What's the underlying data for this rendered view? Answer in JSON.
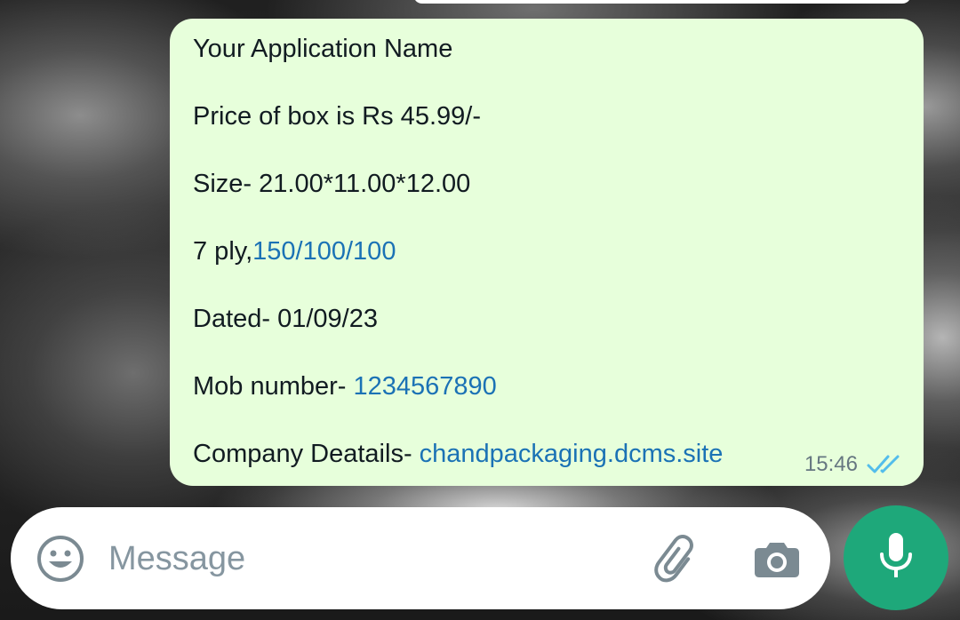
{
  "message": {
    "lines": [
      {
        "text": "Your Application Name"
      },
      {
        "text": "Price of box is Rs 45.99/-"
      },
      {
        "text": "Size- 21.00*11.00*12.00"
      },
      {
        "prefix": "7 ply,",
        "link": "150/100/100"
      },
      {
        "text": "Dated- 01/09/23"
      },
      {
        "prefix": "Mob number- ",
        "link": "1234567890"
      },
      {
        "prefix": "Company Deatails- ",
        "link": "chandpackaging.dcms.site"
      }
    ],
    "time": "15:46",
    "status_icon": "double-check-icon",
    "bubble_color": "#e7ffdb",
    "link_color": "#1b72b5",
    "tick_color": "#53bdeb"
  },
  "composer": {
    "placeholder": "Message",
    "emoji_icon": "emoji-icon",
    "attach_icon": "paperclip-icon",
    "camera_icon": "camera-icon",
    "mic_icon": "microphone-icon",
    "accent": "#1ea87a"
  }
}
